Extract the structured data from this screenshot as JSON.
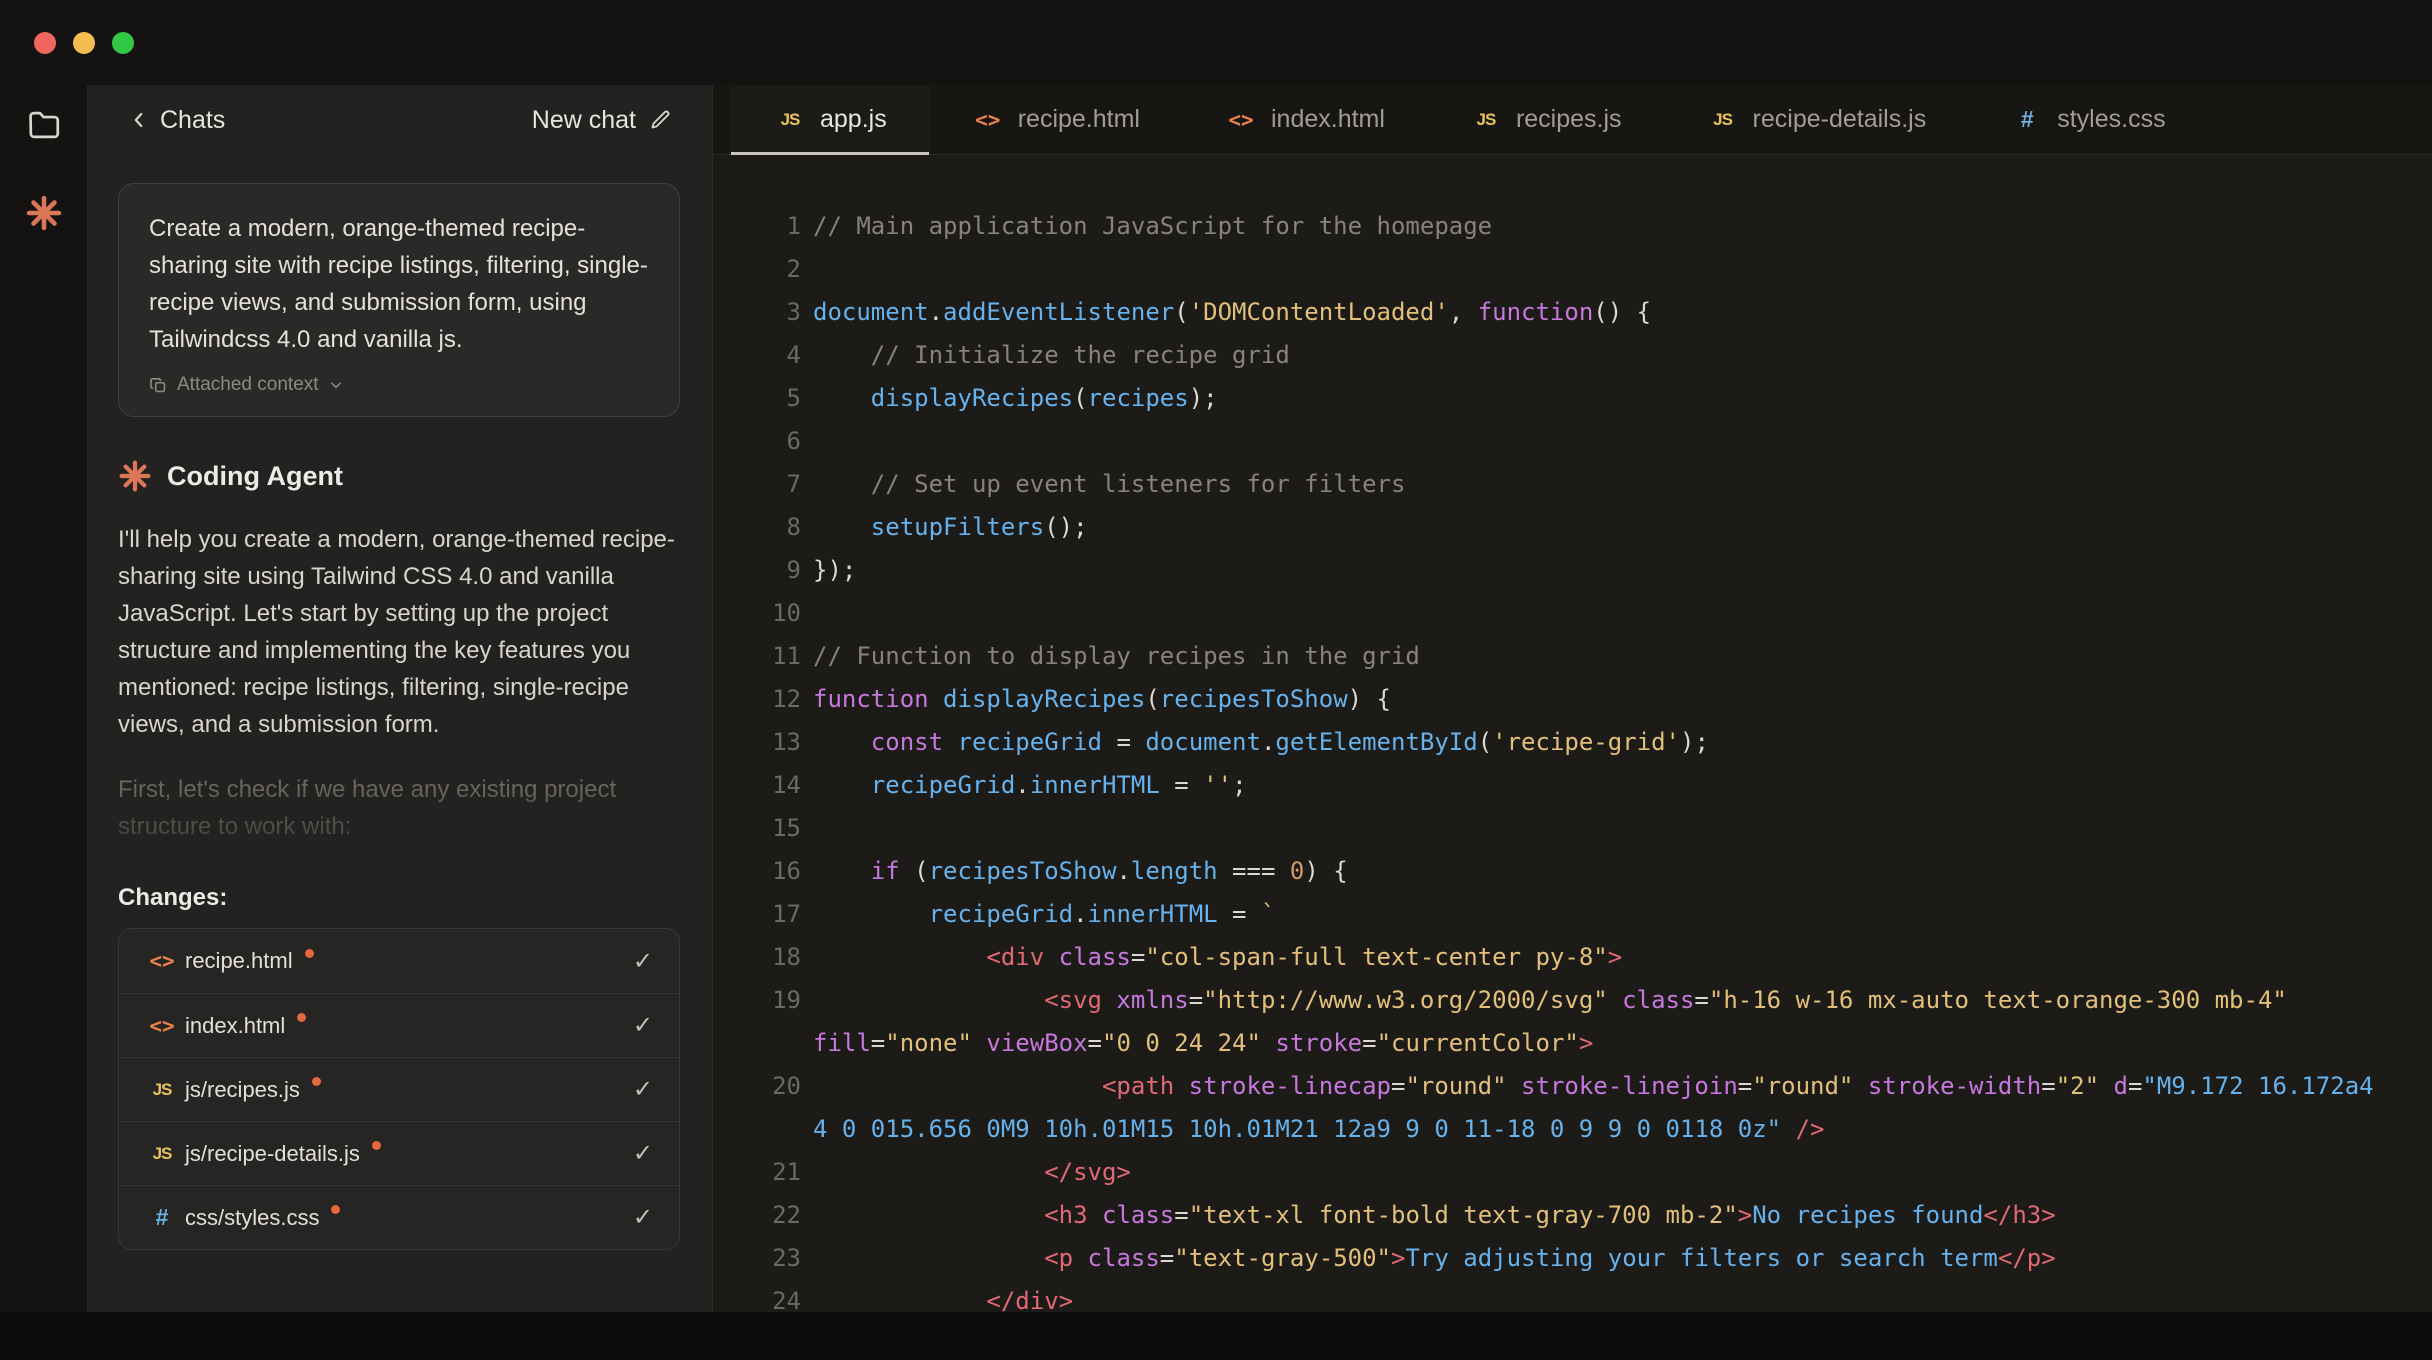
{
  "colors": {
    "accent_orange": "#D97757",
    "modified_dot": "#E5683F",
    "icon_js": "#E8C35A",
    "icon_html": "#E8824B",
    "icon_css": "#6CB2E2",
    "traffic_red": "#F1655F",
    "traffic_yellow": "#F5BD4F",
    "traffic_green": "#33C748",
    "syntax_default": "#DCD9D2",
    "syntax_comment": "#87837A",
    "syntax_keyword": "#C678DD",
    "syntax_ident": "#66B2EC",
    "syntax_string": "#E3C078",
    "syntax_number": "#D19A66",
    "syntax_tag": "#E06973",
    "syntax_attr": "#C678DD"
  },
  "file_icons": {
    "js": "JS",
    "html": "<>",
    "css": "#"
  },
  "glyphs": {
    "check": "✓"
  },
  "chat": {
    "header": {
      "back_label": "Chats",
      "new_chat_label": "New chat"
    },
    "user_message": {
      "text": "Create a modern, orange-themed recipe-sharing site with recipe listings, filtering, single-recipe views, and submission form, using Tailwindcss 4.0 and vanilla js.",
      "attached_context_label": "Attached context"
    },
    "agent_name": "Coding Agent",
    "assistant_paragraph": "I'll help you create a modern, orange-themed recipe-sharing site using Tailwind CSS 4.0 and vanilla JavaScript. Let's start by setting up the project structure and implementing the key features you mentioned: recipe listings, filtering, single-recipe views, and a submission form.",
    "assistant_paragraph_faded": "First, let's check if we have any existing project structure to work with:",
    "changes_label": "Changes:",
    "changes": [
      {
        "file": "recipe.html",
        "type": "html",
        "modified": true,
        "applied": true
      },
      {
        "file": "index.html",
        "type": "html",
        "modified": true,
        "applied": true
      },
      {
        "file": "js/recipes.js",
        "type": "js",
        "modified": true,
        "applied": true
      },
      {
        "file": "js/recipe-details.js",
        "type": "js",
        "modified": true,
        "applied": true
      },
      {
        "file": "css/styles.css",
        "type": "css",
        "modified": true,
        "applied": true
      }
    ]
  },
  "editor": {
    "tabs": [
      {
        "label": "app.js",
        "type": "js",
        "active": true
      },
      {
        "label": "recipe.html",
        "type": "html",
        "active": false
      },
      {
        "label": "index.html",
        "type": "html",
        "active": false
      },
      {
        "label": "recipes.js",
        "type": "js",
        "active": false
      },
      {
        "label": "recipe-details.js",
        "type": "js",
        "active": false
      },
      {
        "label": "styles.css",
        "type": "css",
        "active": false
      }
    ],
    "lines": [
      [
        [
          "c",
          "// Main application JavaScript for the homepage"
        ]
      ],
      [],
      [
        [
          "i",
          "document"
        ],
        [
          "d",
          "."
        ],
        [
          "i",
          "addEventListener"
        ],
        [
          "d",
          "("
        ],
        [
          "s",
          "'DOMContentLoaded'"
        ],
        [
          "d",
          ", "
        ],
        [
          "k",
          "function"
        ],
        [
          "d",
          "() {"
        ]
      ],
      [
        [
          "d",
          "    "
        ],
        [
          "c",
          "// Initialize the recipe grid"
        ]
      ],
      [
        [
          "d",
          "    "
        ],
        [
          "i",
          "displayRecipes"
        ],
        [
          "d",
          "("
        ],
        [
          "i",
          "recipes"
        ],
        [
          "d",
          ");"
        ]
      ],
      [],
      [
        [
          "d",
          "    "
        ],
        [
          "c",
          "// Set up event listeners for filters"
        ]
      ],
      [
        [
          "d",
          "    "
        ],
        [
          "i",
          "setupFilters"
        ],
        [
          "d",
          "();"
        ]
      ],
      [
        [
          "d",
          "});"
        ]
      ],
      [],
      [
        [
          "c",
          "// Function to display recipes in the grid"
        ]
      ],
      [
        [
          "k",
          "function"
        ],
        [
          "d",
          " "
        ],
        [
          "i",
          "displayRecipes"
        ],
        [
          "d",
          "("
        ],
        [
          "i",
          "recipesToShow"
        ],
        [
          "d",
          ") {"
        ]
      ],
      [
        [
          "d",
          "    "
        ],
        [
          "k",
          "const"
        ],
        [
          "d",
          " "
        ],
        [
          "i",
          "recipeGrid"
        ],
        [
          "d",
          " = "
        ],
        [
          "i",
          "document"
        ],
        [
          "d",
          "."
        ],
        [
          "i",
          "getElementById"
        ],
        [
          "d",
          "("
        ],
        [
          "s",
          "'recipe-grid'"
        ],
        [
          "d",
          ");"
        ]
      ],
      [
        [
          "d",
          "    "
        ],
        [
          "i",
          "recipeGrid"
        ],
        [
          "d",
          "."
        ],
        [
          "i",
          "innerHTML"
        ],
        [
          "d",
          " = "
        ],
        [
          "s",
          "''"
        ],
        [
          "d",
          ";"
        ]
      ],
      [],
      [
        [
          "d",
          "    "
        ],
        [
          "k",
          "if"
        ],
        [
          "d",
          " ("
        ],
        [
          "i",
          "recipesToShow"
        ],
        [
          "d",
          "."
        ],
        [
          "i",
          "length"
        ],
        [
          "d",
          " === "
        ],
        [
          "n",
          "0"
        ],
        [
          "d",
          ") {"
        ]
      ],
      [
        [
          "d",
          "        "
        ],
        [
          "i",
          "recipeGrid"
        ],
        [
          "d",
          "."
        ],
        [
          "i",
          "innerHTML"
        ],
        [
          "d",
          " = "
        ],
        [
          "s",
          "`"
        ]
      ],
      [
        [
          "d",
          "            "
        ],
        [
          "g",
          "<div"
        ],
        [
          "a",
          " class"
        ],
        [
          "d",
          "="
        ],
        [
          "s",
          "\"col-span-full text-center py-8\""
        ],
        [
          "g",
          ">"
        ]
      ],
      [
        [
          "d",
          "                "
        ],
        [
          "g",
          "<svg"
        ],
        [
          "a",
          " xmlns"
        ],
        [
          "d",
          "="
        ],
        [
          "s",
          "\"http://www.w3.org/2000/svg\""
        ],
        [
          "a",
          " class"
        ],
        [
          "d",
          "="
        ],
        [
          "s",
          "\"h-16 w-16 mx-auto text-orange-300 mb-4\""
        ],
        [
          "a",
          " fill"
        ],
        [
          "d",
          "="
        ],
        [
          "s",
          "\"none\""
        ],
        [
          "a",
          " viewBox"
        ],
        [
          "d",
          "="
        ],
        [
          "s",
          "\"0 0 24 24\""
        ],
        [
          "a",
          " stroke"
        ],
        [
          "d",
          "="
        ],
        [
          "s",
          "\"currentColor\""
        ],
        [
          "g",
          ">"
        ]
      ],
      [
        [
          "d",
          "                    "
        ],
        [
          "g",
          "<path"
        ],
        [
          "a",
          " stroke-linecap"
        ],
        [
          "d",
          "="
        ],
        [
          "s",
          "\"round\""
        ],
        [
          "a",
          " stroke-linejoin"
        ],
        [
          "d",
          "="
        ],
        [
          "s",
          "\"round\""
        ],
        [
          "a",
          " stroke-width"
        ],
        [
          "d",
          "="
        ],
        [
          "s",
          "\"2\""
        ],
        [
          "a",
          " d"
        ],
        [
          "d",
          "="
        ],
        [
          "i",
          "\"M9.172 16.172a4 4 0 015.656 0M9 10h.01M15 10h.01M21 12a9 9 0 11-18 0 9 9 0 0118 0z\""
        ],
        [
          "d",
          " "
        ],
        [
          "g",
          "/>"
        ]
      ],
      [
        [
          "d",
          "                "
        ],
        [
          "g",
          "</svg>"
        ]
      ],
      [
        [
          "d",
          "                "
        ],
        [
          "g",
          "<h3"
        ],
        [
          "a",
          " class"
        ],
        [
          "d",
          "="
        ],
        [
          "s",
          "\"text-xl font-bold text-gray-700 mb-2\""
        ],
        [
          "g",
          ">"
        ],
        [
          "i",
          "No recipes found"
        ],
        [
          "g",
          "</h3>"
        ]
      ],
      [
        [
          "d",
          "                "
        ],
        [
          "g",
          "<p"
        ],
        [
          "a",
          " class"
        ],
        [
          "d",
          "="
        ],
        [
          "s",
          "\"text-gray-500\""
        ],
        [
          "g",
          ">"
        ],
        [
          "i",
          "Try adjusting your filters or search term"
        ],
        [
          "g",
          "</p>"
        ]
      ],
      [
        [
          "d",
          "            "
        ],
        [
          "g",
          "</div>"
        ]
      ]
    ]
  }
}
